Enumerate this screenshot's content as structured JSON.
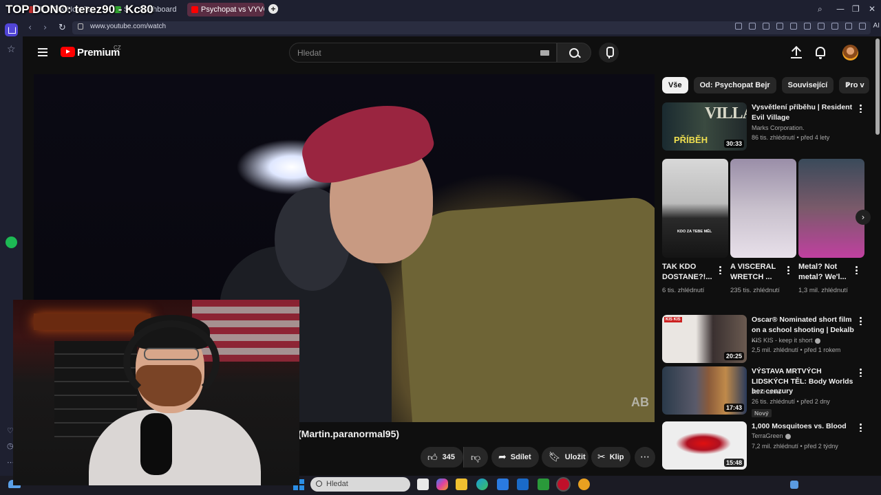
{
  "stream_overlay": "TOP DONO: terez90 - Kc80",
  "browser": {
    "tabs": [
      {
        "label": "Ti... FIX How Te...",
        "active": false
      },
      {
        "label": "St... Dashboard",
        "active": false
      },
      {
        "label": "Psychopat vs VYVOLALI J...",
        "active": true
      }
    ],
    "url": "www.youtube.com/watch",
    "ai_label": "AI"
  },
  "youtube": {
    "logo": "Premium",
    "logo_country": "CZ",
    "search_placeholder": "Hledat"
  },
  "video": {
    "title_visible": "Martin.paranormal95)",
    "watermark": "AB",
    "like_count": "345",
    "share_label": "Sdílet",
    "save_label": "Uložit",
    "clip_label": "Klip"
  },
  "chips": [
    "Vše",
    "Od: Psychopat Bejr",
    "Související",
    "Pro v"
  ],
  "recommendations": [
    {
      "title": "Vysvětlení příběhu | Resident Evil Village",
      "channel": "Marks Corporation.",
      "meta": "86 tis. zhlédnutí • před 4 lety",
      "duration": "30:33",
      "verified": false,
      "badge": ""
    },
    {
      "title": "Oscar® Nominated short film on a school shooting | Dekalb ...",
      "channel": "KIS KIS - keep it short",
      "meta": "2,5 mil. zhlédnutí • před 1 rokem",
      "duration": "20:25",
      "verified": true,
      "badge": ""
    },
    {
      "title": "VÝSTAVA MRTVÝCH LIDSKÝCH TĚL: Body Worlds bez cenzury",
      "channel": "Jan Hanko",
      "meta": "26 tis. zhlédnutí • před 2 dny",
      "duration": "17:43",
      "verified": false,
      "badge": "Nový"
    },
    {
      "title": "1,000 Mosquitoes vs. Blood",
      "channel": "TerraGreen",
      "meta": "7,2 mil. zhlédnutí • před 2 týdny",
      "duration": "15:48",
      "verified": true,
      "badge": ""
    }
  ],
  "shorts": [
    {
      "title": "TAK KDO DOSTANE?!...",
      "views": "6 tis. zhlédnutí",
      "caption": "KDO ZA TEBE MĚL"
    },
    {
      "title": "A VISCERAL WRETCH ...",
      "views": "235 tis. zhlédnutí"
    },
    {
      "title": "Metal? Not metal? We'l...",
      "views": "1,3 mil. zhlédnutí"
    }
  ],
  "thumb_text": {
    "village": "VILLAGE",
    "pribeh": "PŘÍBĚH",
    "kis": "KIS KIS"
  },
  "taskbar": {
    "search_placeholder": "Hledat"
  }
}
